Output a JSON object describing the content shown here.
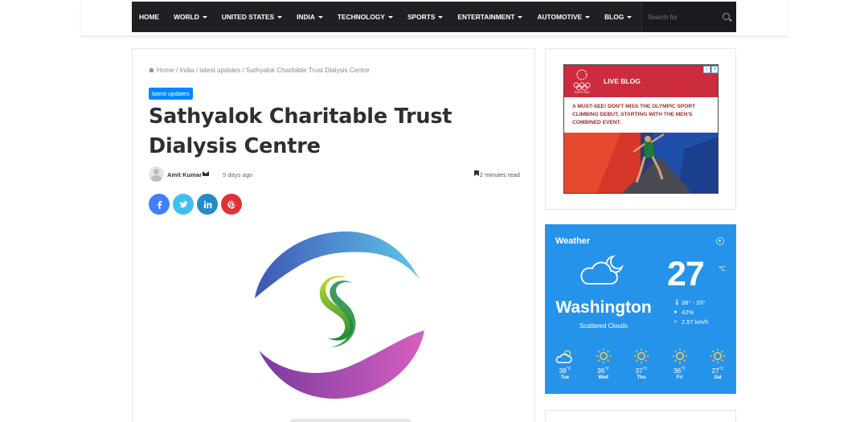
{
  "nav": {
    "items": [
      {
        "label": "HOME",
        "dropdown": false
      },
      {
        "label": "WORLD",
        "dropdown": true
      },
      {
        "label": "UNITED STATES",
        "dropdown": true
      },
      {
        "label": "INDIA",
        "dropdown": true
      },
      {
        "label": "TECHNOLOGY",
        "dropdown": true
      },
      {
        "label": "SPORTS",
        "dropdown": true
      },
      {
        "label": "ENTERTAINMENT",
        "dropdown": true
      },
      {
        "label": "AUTOMOTIVE",
        "dropdown": true
      },
      {
        "label": "BLOG",
        "dropdown": true
      }
    ],
    "search_placeholder": "Search for"
  },
  "article": {
    "breadcrumb": {
      "home": "Home",
      "sep": "/",
      "crumbs": [
        "India",
        "latest updates",
        "Sathyalok Charitable Trust Dialysis Centre"
      ]
    },
    "category": "latest updates",
    "title_line1": "Sathyalok Charitable Trust",
    "title_line2": "Dialysis Centre",
    "author": "Amit Kumar",
    "date": "5 days ago",
    "read_time": "2 minutes read",
    "share_buttons": [
      {
        "name": "facebook",
        "color": "#4080ff"
      },
      {
        "name": "twitter",
        "color": "#40bff5"
      },
      {
        "name": "linkedin",
        "color": "#238cc8"
      },
      {
        "name": "pinterest",
        "color": "#e13138"
      }
    ]
  },
  "ad": {
    "label": "LIVE BLOG",
    "logo_text": "TOKYO 2020",
    "text": "A MUST-SEE! DON'T MISS THE OLYMPIC SPORT CLIMBING DEBUT, STARTING WITH THE MEN'S COMBINED EVENT."
  },
  "weather": {
    "title": "Weather",
    "temperature": "27",
    "unit": "℃",
    "city": "Washington",
    "description": "Scattered Clouds",
    "range": "38° - 20°",
    "humidity": "42%",
    "wind": "2.57 km/h",
    "forecast": [
      {
        "day": "Tue",
        "temp": "38",
        "icon": "cloud-sun-icon"
      },
      {
        "day": "Wed",
        "temp": "36",
        "icon": "sun-icon"
      },
      {
        "day": "Thu",
        "temp": "37",
        "icon": "sun-icon"
      },
      {
        "day": "Fri",
        "temp": "36",
        "icon": "sun-icon"
      },
      {
        "day": "Sat",
        "temp": "27",
        "icon": "sun-icon"
      }
    ],
    "forecast_unit": "℃"
  },
  "colors": {
    "nav_bg": "#1f2024",
    "category_badge": "#0088ff",
    "weather_bg": "#2593ea",
    "ad_red": "#cc2c3e"
  }
}
